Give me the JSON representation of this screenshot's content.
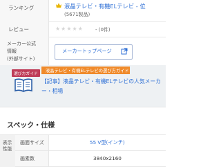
{
  "ranking": {
    "label": "ランキング",
    "link_text": "液晶テレビ・有機ELテレビ - 位",
    "count": "(5671製品)"
  },
  "review": {
    "label": "レビュー",
    "stars": "★★★★★",
    "count": "- (0件)"
  },
  "maker": {
    "label_lines": [
      "メーカー公式",
      "情報",
      "(外部サイト)"
    ],
    "button_label": "メーカートップページ"
  },
  "guide": {
    "badge": "選び方ガイド",
    "banner": "液晶テレビ・有機ELテレビの選び方ガイド",
    "article_title": "【記事】液晶テレビ・有機ELテレビの人気メーカー・相場"
  },
  "spec": {
    "section_title": "スペック・仕様",
    "side_label": "表示性能",
    "rows": [
      {
        "label": "画面サイズ",
        "value": "55 V型(インチ)"
      },
      {
        "label": "画素数",
        "value": "3840x2160"
      }
    ]
  },
  "colors": {
    "link": "#2c6ed5",
    "guide_badge": "#bf3c57",
    "guide_banner": "#f08a2a",
    "crown": "#e8b400"
  }
}
